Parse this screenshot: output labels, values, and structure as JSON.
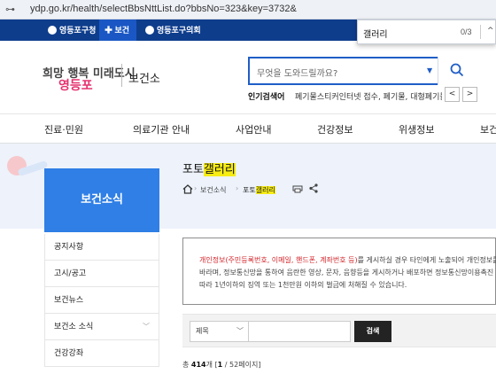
{
  "browser": {
    "url": "ydp.go.kr/health/selectBbsNttList.do?bbsNo=323&key=3732&"
  },
  "find_bar": {
    "query": "갤러리",
    "count": "0/3"
  },
  "gov_strip": {
    "tabs": [
      "영등포구청",
      "보건소",
      "영등포구의회"
    ]
  },
  "header": {
    "logo_slogan": "희망 행복 미래도시",
    "logo_city": "영등포",
    "site_name": "보건소",
    "search_placeholder": "무엇을 도와드릴까요?",
    "popular_label": "인기검색어",
    "popular_keywords": "폐기물스티커인터넷 접수, 폐기물, 대형폐기물, 대"
  },
  "gnb": {
    "items": [
      "진료·민원",
      "의료기관 안내",
      "사업안내",
      "건강정보",
      "위생정보",
      "보건"
    ]
  },
  "sidebar": {
    "title": "보건소식",
    "items": [
      {
        "label": "공지사항"
      },
      {
        "label": "고시/공고"
      },
      {
        "label": "보건뉴스"
      },
      {
        "label": "보건소 소식"
      },
      {
        "label": "건강강좌"
      }
    ]
  },
  "content": {
    "title_prefix": "포토",
    "title_highlight": "갤러리",
    "breadcrumb": [
      "보건소식",
      "포토갤러리"
    ],
    "breadcrumb_last_prefix": "포토",
    "breadcrumb_last_highlight": "갤러리",
    "notice": {
      "line1_red": "개인정보(주민등록번호, 이메일, 핸드폰, 계좌번호 등)",
      "line1_rest": "를 게시하실 경우 타인에게 노출되어 개인정보를",
      "line2": "바라며, 정보통신망을 통하여 음란한 영상, 문자, 음향등을 게시하거나 배포하면 정보통신망이용촉진",
      "line3": "따라 1년이하의 징역 또는 1천만원 이하의 벌금에 처해질 수 있습니다."
    },
    "filter": {
      "select_value": "제목",
      "search_button": "검색"
    },
    "count": {
      "label": "총",
      "total": "414",
      "unit": "개",
      "page_current": "1",
      "page_sep": "/",
      "page_total": "52",
      "page_suffix": "페이지"
    }
  }
}
